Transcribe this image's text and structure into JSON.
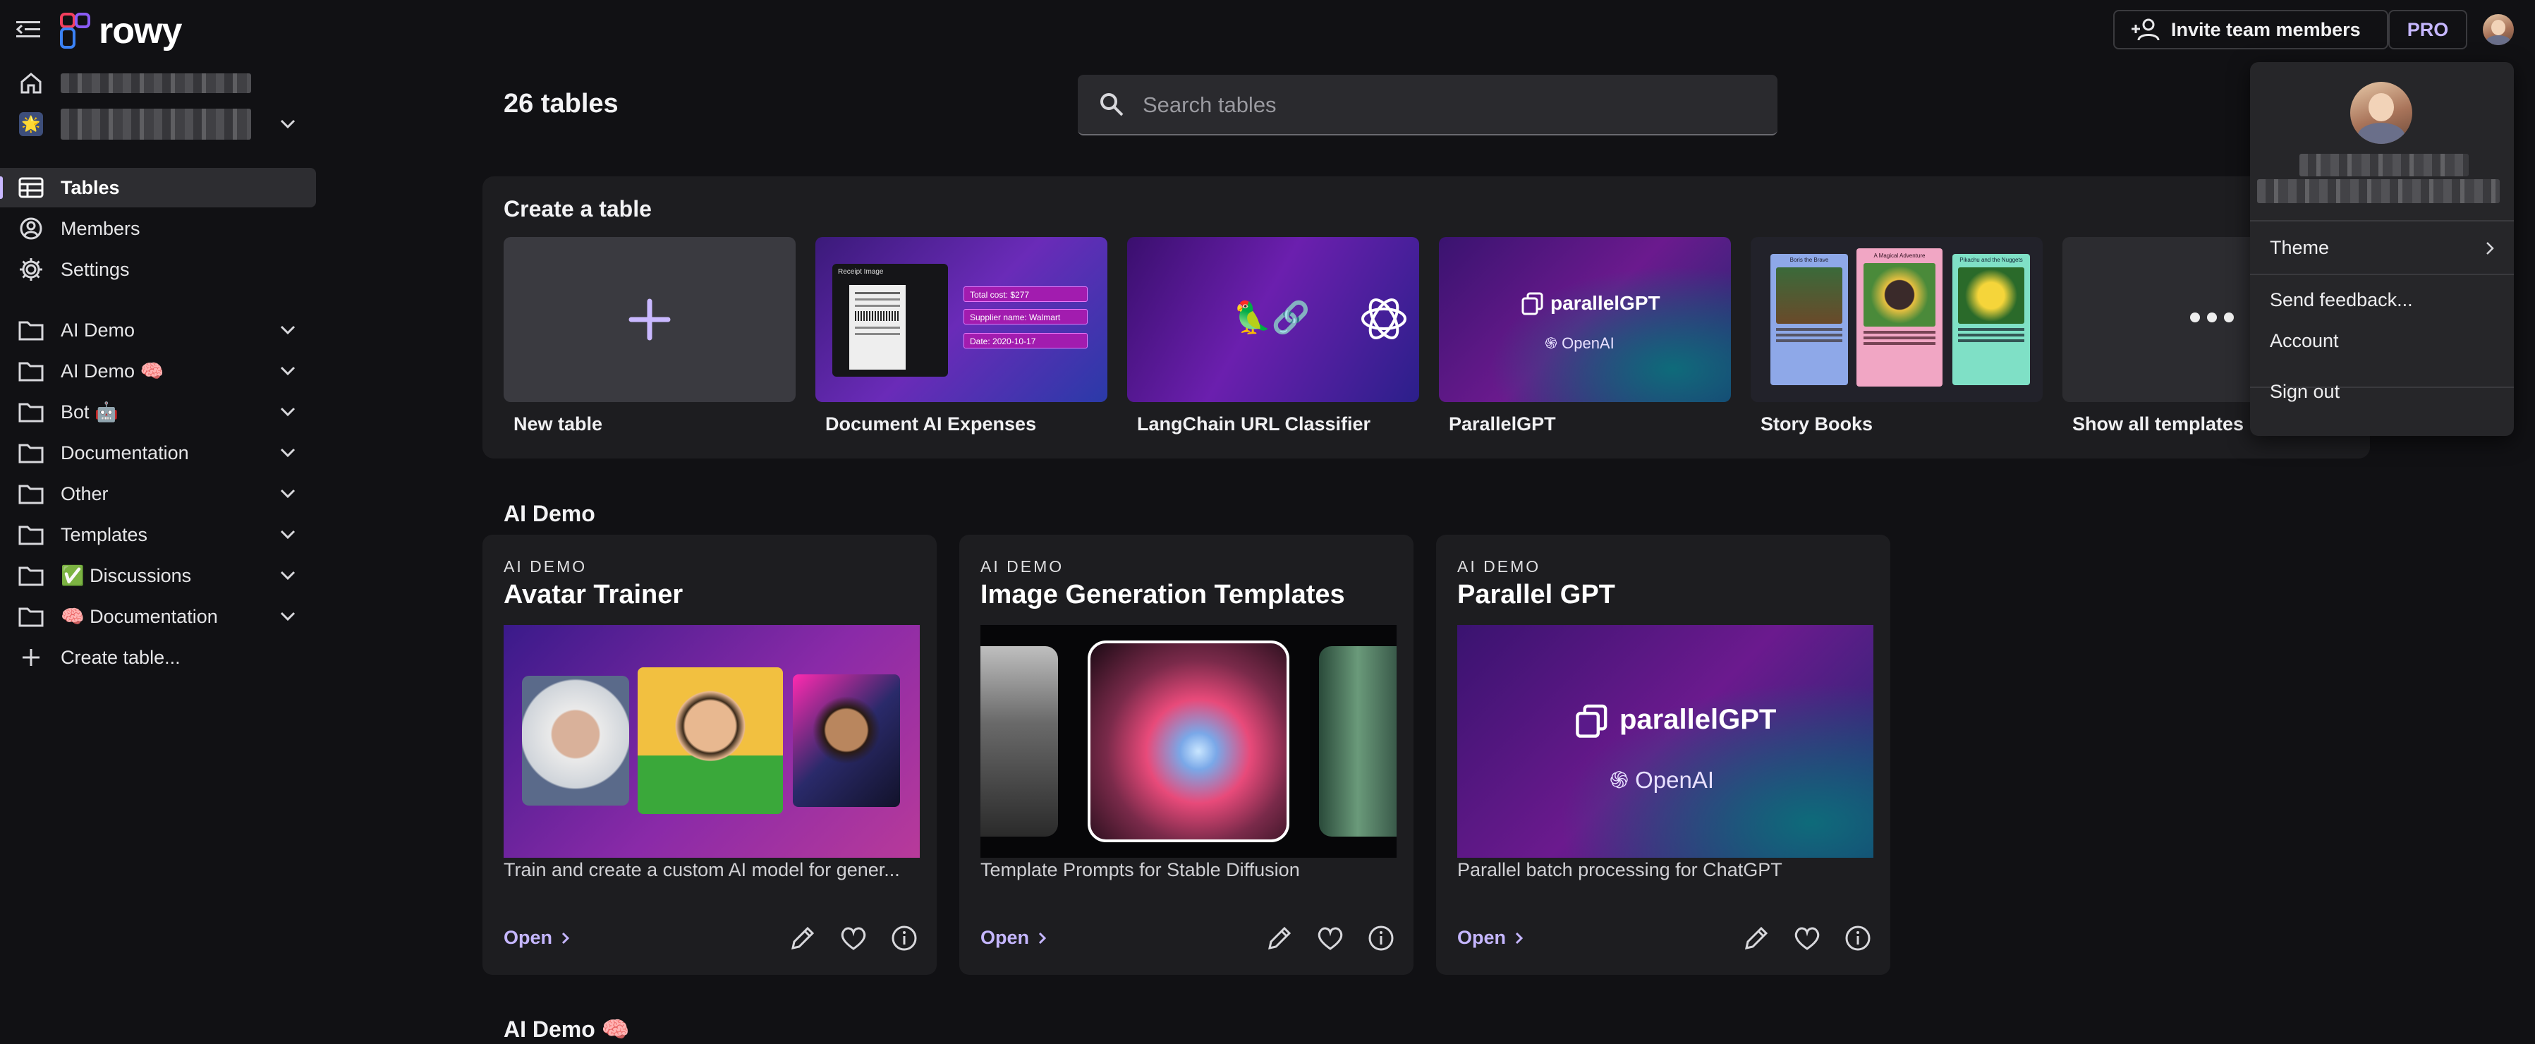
{
  "app": {
    "logo_text": "rowy",
    "brand_color": "#8b5cf6"
  },
  "header": {
    "invite_label": "Invite team members",
    "pro_label": "PRO"
  },
  "sidebar": {
    "items": [
      {
        "label": "Tables",
        "icon": "table-icon",
        "active": true
      },
      {
        "label": "Members",
        "icon": "members-icon"
      },
      {
        "label": "Settings",
        "icon": "settings-icon"
      }
    ],
    "sections": [
      {
        "label": "AI Demo"
      },
      {
        "label": "AI Demo 🧠"
      },
      {
        "label": "Bot 🤖"
      },
      {
        "label": "Documentation"
      },
      {
        "label": "Other"
      },
      {
        "label": "Templates"
      },
      {
        "label": "✅ Discussions"
      },
      {
        "label": "🧠 Documentation"
      }
    ],
    "create_label": "Create table..."
  },
  "main": {
    "title": "26 tables",
    "search_placeholder": "Search tables",
    "create_section_title": "Create a table",
    "templates": [
      {
        "label": "New table"
      },
      {
        "label": "Document AI Expenses"
      },
      {
        "label": "LangChain URL Classifier"
      },
      {
        "label": "ParallelGPT"
      },
      {
        "label": "Story Books"
      },
      {
        "label": "Show all templates"
      }
    ],
    "doc_ai_thumb": {
      "receipt_title": "Receipt Image",
      "total": "Total cost: $277",
      "supplier": "Supplier name: Walmart",
      "date": "Date: 2020-10-17"
    },
    "parallel_thumb": {
      "brand": "parallelGPT",
      "sub": "OpenAI"
    },
    "story_thumb": {
      "b1": "Boris the Brave",
      "b2": "A Magical Adventure",
      "b3": "Pikachu and the Nuggets"
    },
    "group_title": "AI Demo",
    "cards": [
      {
        "category": "AI DEMO",
        "title": "Avatar Trainer",
        "description": "Train and create a custom AI model for gener...",
        "open_label": "Open"
      },
      {
        "category": "AI DEMO",
        "title": "Image Generation Templates",
        "description": "Template Prompts for Stable Diffusion",
        "open_label": "Open"
      },
      {
        "category": "AI DEMO",
        "title": "Parallel GPT",
        "description": "Parallel batch processing for ChatGPT",
        "open_label": "Open",
        "brand": "parallelGPT",
        "sub": "OpenAI"
      }
    ],
    "next_group_title": "AI Demo 🧠"
  },
  "account_menu": {
    "items": [
      {
        "label": "Theme"
      },
      {
        "label": "Send feedback..."
      },
      {
        "label": "Account"
      },
      {
        "label": "Sign out"
      }
    ]
  }
}
